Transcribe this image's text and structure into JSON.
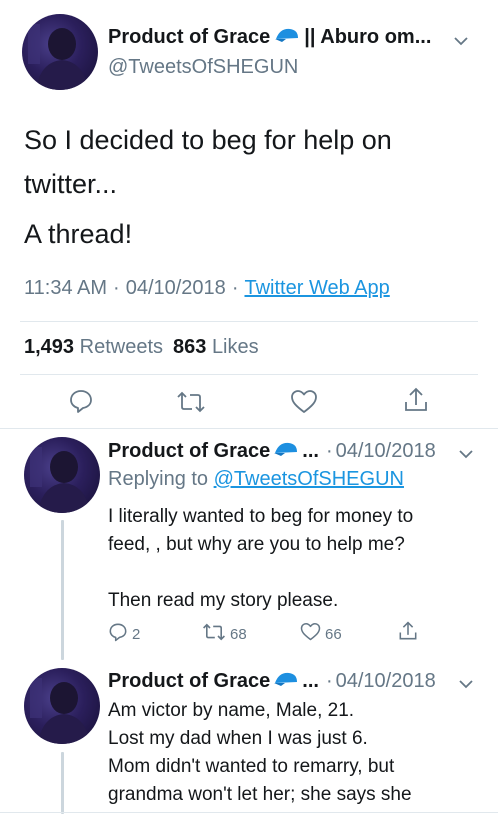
{
  "main_tweet": {
    "display_name": "Product of Grace",
    "name_suffix": "|| Aburo om...",
    "handle": "@TweetsOfSHEGUN",
    "text_line1": "So I decided to beg for help on",
    "text_line2": "twitter...",
    "text_line3": "A thread!",
    "time": "11:34 AM",
    "separator": "·",
    "date": "04/10/2018",
    "source": "Twitter Web App",
    "retweets_count": "1,493",
    "retweets_label": "Retweets",
    "likes_count": "863",
    "likes_label": "Likes"
  },
  "reply1": {
    "display_name": "Product of Grace",
    "ellipsis": "...",
    "separator": "·",
    "date": "04/10/2018",
    "replying_prefix": "Replying to",
    "replying_handle": "@TweetsOfSHEGUN",
    "text_line1": "I literally wanted to beg for money to",
    "text_line2": "feed, , but why are you to help me?",
    "text_line3": "Then read my story please.",
    "reply_count": "2",
    "retweet_count": "68",
    "like_count": "66"
  },
  "reply2": {
    "display_name": "Product of Grace",
    "ellipsis": "...",
    "separator": "·",
    "date": "04/10/2018",
    "text_line1": "Am victor by name, Male, 21.",
    "text_line2": "Lost my dad when I was just 6.",
    "text_line3": "Mom didn't wanted to remarry, but",
    "text_line4": "grandma won't let her; she says she"
  },
  "colors": {
    "link": "#1b95e0",
    "muted": "#657786",
    "text": "#14171a",
    "badge_blue": "#1d8fe0"
  },
  "icons": [
    "chevron-down-icon",
    "blue-cap-emoji-icon",
    "reply-icon",
    "retweet-icon",
    "like-icon",
    "share-icon"
  ]
}
